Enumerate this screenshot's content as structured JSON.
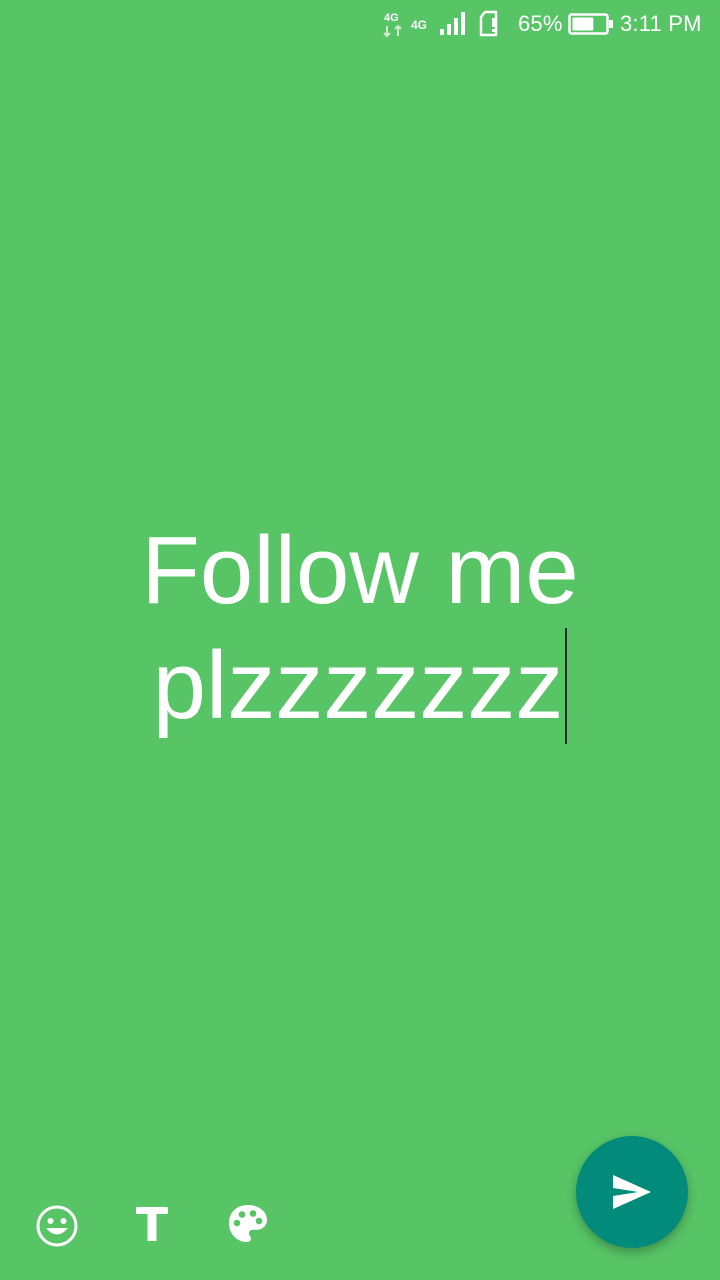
{
  "status_bar": {
    "network_1": "4G",
    "network_2": "4G",
    "battery_percent": "65%",
    "battery_level": 0.65,
    "time": "3:11 PM"
  },
  "editor": {
    "status_text": "Follow me plzzzzzzz",
    "background_color": "#57c466"
  },
  "toolbar": {
    "icons": [
      "emoji-icon",
      "text-format-icon",
      "palette-icon"
    ]
  },
  "send_button": {
    "icon": "send-icon",
    "color": "#028a7b"
  }
}
